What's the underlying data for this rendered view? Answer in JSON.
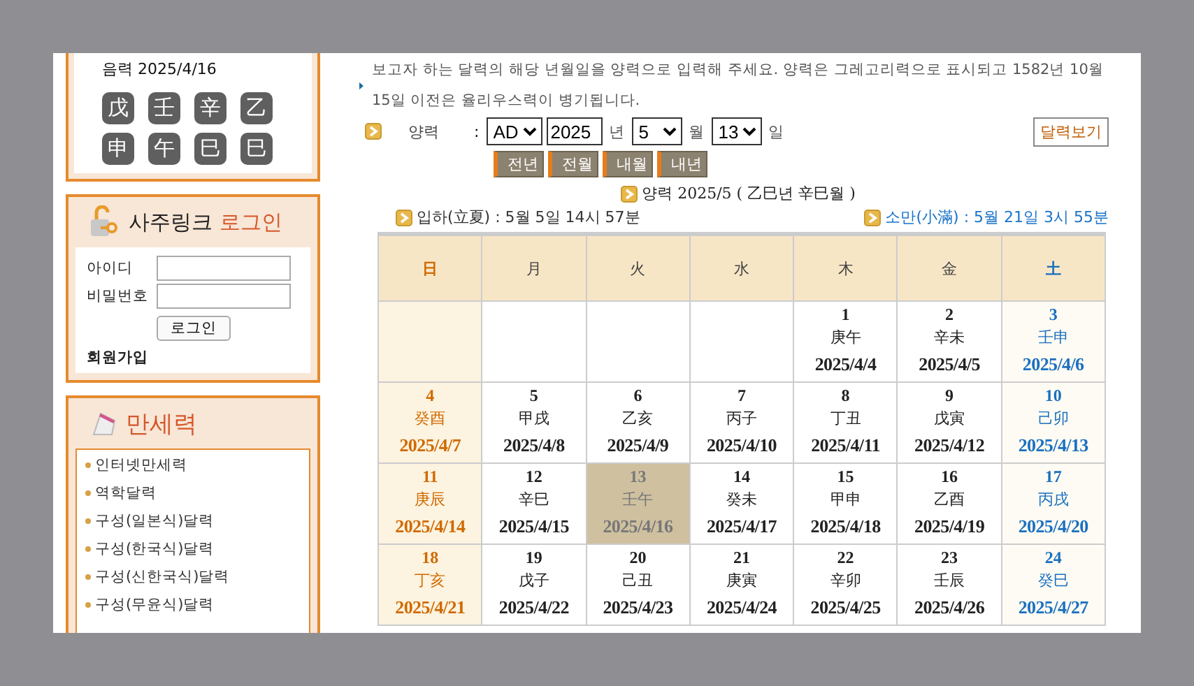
{
  "lunar_date": "음력 2025/4/16",
  "pillars": [
    {
      "top": "戊",
      "bottom": "申"
    },
    {
      "top": "壬",
      "bottom": "午"
    },
    {
      "top": "辛",
      "bottom": "巳"
    },
    {
      "top": "乙",
      "bottom": "巳"
    }
  ],
  "login": {
    "title": "사주링크",
    "title_highlight": "로그인",
    "fields": [
      {
        "label": "아이디"
      },
      {
        "label": "비밀번호"
      }
    ],
    "button": "로그인",
    "signup": "회원가입"
  },
  "menu": {
    "title": "만세력",
    "items": [
      "인터넷만세력",
      "역학달력",
      "구성(일본식)달력",
      "구성(한국식)달력",
      "구성(신한국식)달력",
      "구성(무윤식)달력"
    ]
  },
  "notice": "보고자 하는 달력의 해당 년월일을 양력으로 입력해 주세요. 양력은 그레고리력으로 표시되고 1582년 10월 15일 이전은 율리우스력이 병기됩니다.",
  "form": {
    "label": "양력",
    "colon": ":",
    "era": "AD",
    "year": "2025",
    "year_unit": "년",
    "month": "5",
    "month_unit": "월",
    "day": "13",
    "day_unit": "일",
    "submit": "달력보기"
  },
  "nav_buttons": [
    "전년",
    "전월",
    "내월",
    "내년"
  ],
  "month_title": "양력 2025/5 ( 乙巳년 辛巳월 )",
  "solar_terms": [
    {
      "text": "입하(立夏) : 5월 5일 14시 57분",
      "color": "#333333"
    },
    {
      "text": "소만(小滿) : 5월 21일 3시 55분",
      "color": "#1a73c8"
    }
  ],
  "calendar": {
    "columns": [
      {
        "label": "日",
        "kind": "sunday"
      },
      {
        "label": "月",
        "kind": "weekday"
      },
      {
        "label": "火",
        "kind": "weekday"
      },
      {
        "label": "水",
        "kind": "weekday"
      },
      {
        "label": "木",
        "kind": "weekday"
      },
      {
        "label": "金",
        "kind": "weekday"
      },
      {
        "label": "土",
        "kind": "saturday"
      }
    ],
    "weeks": [
      [
        {
          "kind": "blank"
        },
        {
          "kind": "blank"
        },
        {
          "kind": "blank"
        },
        {
          "kind": "blank"
        },
        {
          "kind": "day",
          "day": "1",
          "ganzhi": "庚午",
          "lunar": "2025/4/4",
          "selected": false
        },
        {
          "kind": "day",
          "day": "2",
          "ganzhi": "辛未",
          "lunar": "2025/4/5",
          "selected": false
        },
        {
          "kind": "day",
          "day": "3",
          "ganzhi": "壬申",
          "lunar": "2025/4/6",
          "selected": false
        }
      ],
      [
        {
          "kind": "day",
          "day": "4",
          "ganzhi": "癸酉",
          "lunar": "2025/4/7",
          "selected": false
        },
        {
          "kind": "day",
          "day": "5",
          "ganzhi": "甲戌",
          "lunar": "2025/4/8",
          "selected": false
        },
        {
          "kind": "day",
          "day": "6",
          "ganzhi": "乙亥",
          "lunar": "2025/4/9",
          "selected": false
        },
        {
          "kind": "day",
          "day": "7",
          "ganzhi": "丙子",
          "lunar": "2025/4/10",
          "selected": false
        },
        {
          "kind": "day",
          "day": "8",
          "ganzhi": "丁丑",
          "lunar": "2025/4/11",
          "selected": false
        },
        {
          "kind": "day",
          "day": "9",
          "ganzhi": "戊寅",
          "lunar": "2025/4/12",
          "selected": false
        },
        {
          "kind": "day",
          "day": "10",
          "ganzhi": "己卯",
          "lunar": "2025/4/13",
          "selected": false
        }
      ],
      [
        {
          "kind": "day",
          "day": "11",
          "ganzhi": "庚辰",
          "lunar": "2025/4/14",
          "selected": false
        },
        {
          "kind": "day",
          "day": "12",
          "ganzhi": "辛巳",
          "lunar": "2025/4/15",
          "selected": false
        },
        {
          "kind": "day",
          "day": "13",
          "ganzhi": "壬午",
          "lunar": "2025/4/16",
          "selected": true
        },
        {
          "kind": "day",
          "day": "14",
          "ganzhi": "癸未",
          "lunar": "2025/4/17",
          "selected": false
        },
        {
          "kind": "day",
          "day": "15",
          "ganzhi": "甲申",
          "lunar": "2025/4/18",
          "selected": false
        },
        {
          "kind": "day",
          "day": "16",
          "ganzhi": "乙酉",
          "lunar": "2025/4/19",
          "selected": false
        },
        {
          "kind": "day",
          "day": "17",
          "ganzhi": "丙戌",
          "lunar": "2025/4/20",
          "selected": false
        }
      ],
      [
        {
          "kind": "day",
          "day": "18",
          "ganzhi": "丁亥",
          "lunar": "2025/4/21",
          "selected": false
        },
        {
          "kind": "day",
          "day": "19",
          "ganzhi": "戊子",
          "lunar": "2025/4/22",
          "selected": false
        },
        {
          "kind": "day",
          "day": "20",
          "ganzhi": "己丑",
          "lunar": "2025/4/23",
          "selected": false
        },
        {
          "kind": "day",
          "day": "21",
          "ganzhi": "庚寅",
          "lunar": "2025/4/24",
          "selected": false
        },
        {
          "kind": "day",
          "day": "22",
          "ganzhi": "辛卯",
          "lunar": "2025/4/25",
          "selected": false
        },
        {
          "kind": "day",
          "day": "23",
          "ganzhi": "壬辰",
          "lunar": "2025/4/26",
          "selected": false
        },
        {
          "kind": "day",
          "day": "24",
          "ganzhi": "癸巳",
          "lunar": "2025/4/27",
          "selected": false
        }
      ]
    ]
  }
}
